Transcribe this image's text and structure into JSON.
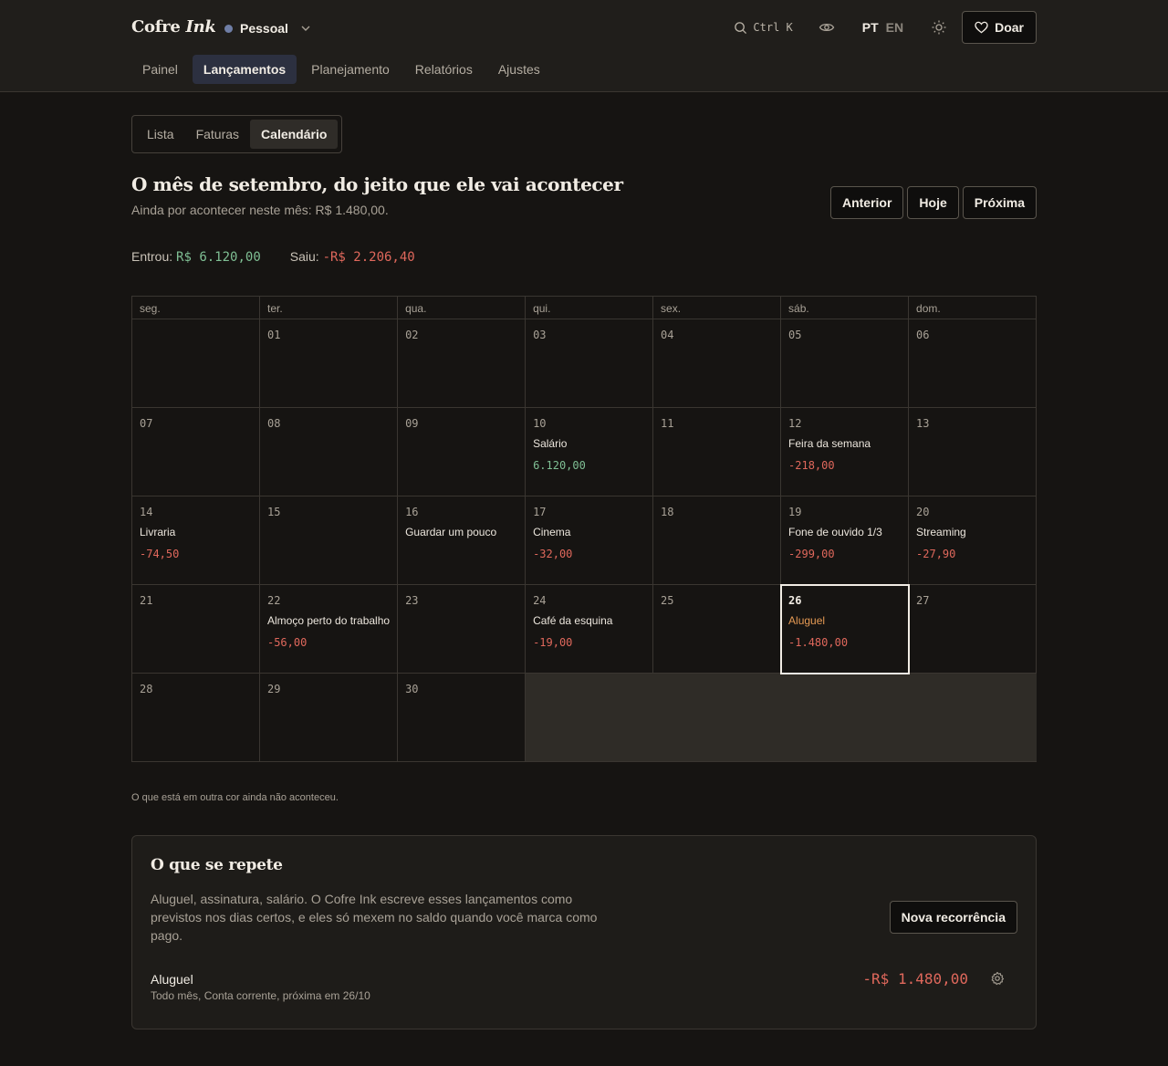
{
  "brand": {
    "name": "Cofre",
    "accent": "Ink"
  },
  "workspace": {
    "label": "Pessoal",
    "dot_color": "#6f7ea6"
  },
  "search": {
    "shortcut": "Ctrl K"
  },
  "languages": {
    "active": "PT",
    "other": "EN"
  },
  "donate": {
    "label": "Doar"
  },
  "nav": [
    {
      "label": "Painel",
      "active": false
    },
    {
      "label": "Lançamentos",
      "active": true
    },
    {
      "label": "Planejamento",
      "active": false
    },
    {
      "label": "Relatórios",
      "active": false
    },
    {
      "label": "Ajustes",
      "active": false
    }
  ],
  "subtabs": [
    {
      "label": "Lista",
      "active": false
    },
    {
      "label": "Faturas",
      "active": false
    },
    {
      "label": "Calendário",
      "active": true
    }
  ],
  "page": {
    "title": "O mês de setembro, do jeito que ele vai acontecer",
    "subtitle": "Ainda por acontecer neste mês: R$ 1.480,00."
  },
  "month_nav": {
    "prev": "Anterior",
    "today": "Hoje",
    "next": "Próxima"
  },
  "totals": {
    "in_label": "Entrou:",
    "in_value": "R$ 6.120,00",
    "out_label": "Saiu:",
    "out_value": "-R$ 2.206,40"
  },
  "calendar": {
    "weekdays": [
      "seg.",
      "ter.",
      "qua.",
      "qui.",
      "sex.",
      "sáb.",
      "dom."
    ],
    "days": [
      {
        "day": "",
        "blank": true
      },
      {
        "day": "01"
      },
      {
        "day": "02"
      },
      {
        "day": "03"
      },
      {
        "day": "04"
      },
      {
        "day": "05"
      },
      {
        "day": "06"
      },
      {
        "day": "07"
      },
      {
        "day": "08"
      },
      {
        "day": "09"
      },
      {
        "day": "10",
        "label": "Salário",
        "amount": "6.120,00",
        "sign": "pos"
      },
      {
        "day": "11"
      },
      {
        "day": "12",
        "label": "Feira da semana",
        "amount": "-218,00",
        "sign": "neg"
      },
      {
        "day": "13"
      },
      {
        "day": "14",
        "label": "Livraria",
        "amount": "-74,50",
        "sign": "neg"
      },
      {
        "day": "15"
      },
      {
        "day": "16",
        "label": "Guardar um pouco"
      },
      {
        "day": "17",
        "label": "Cinema",
        "amount": "-32,00",
        "sign": "neg"
      },
      {
        "day": "18"
      },
      {
        "day": "19",
        "label": "Fone de ouvido 1/3",
        "amount": "-299,00",
        "sign": "neg"
      },
      {
        "day": "20",
        "label": "Streaming",
        "amount": "-27,90",
        "sign": "neg"
      },
      {
        "day": "21"
      },
      {
        "day": "22",
        "label": "Almoço perto do trabalho",
        "amount": "-56,00",
        "sign": "neg"
      },
      {
        "day": "23"
      },
      {
        "day": "24",
        "label": "Café da esquina",
        "amount": "-19,00",
        "sign": "neg"
      },
      {
        "day": "25"
      },
      {
        "day": "26",
        "label": "Aluguel",
        "amount": "-1.480,00",
        "sign": "neg",
        "today": true,
        "pending": true
      },
      {
        "day": "27"
      },
      {
        "day": "28"
      },
      {
        "day": "29"
      },
      {
        "day": "30"
      }
    ]
  },
  "legend_note": "O que está em outra cor ainda não aconteceu.",
  "recurring": {
    "title": "O que se repete",
    "description": "Aluguel, assinatura, salário. O Cofre Ink escreve esses lançamentos como previstos nos dias certos, e eles só mexem no saldo quando você marca como pago.",
    "new_button": "Nova recorrência",
    "items": [
      {
        "name": "Aluguel",
        "meta": "Todo mês, Conta corrente, próxima em 26/10",
        "amount": "-R$ 1.480,00"
      }
    ]
  },
  "colors": {
    "positive": "#7fbf94",
    "negative": "#e0685c",
    "pending": "#e59a54",
    "accent_nav": "#2c3040"
  }
}
